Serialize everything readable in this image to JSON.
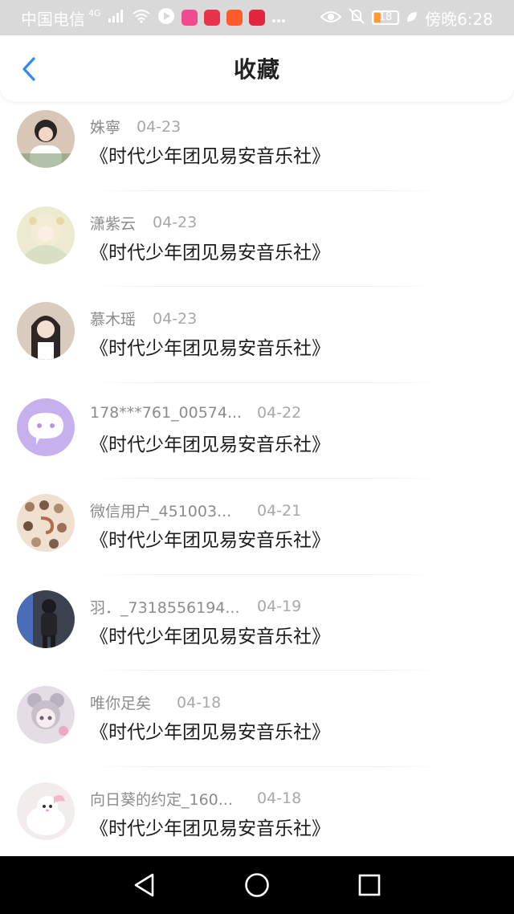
{
  "status_bar": {
    "carrier": "中国电信",
    "network": "4G",
    "battery": "18",
    "time": "傍晚6:28"
  },
  "header": {
    "title": "收藏"
  },
  "items": [
    {
      "name": "姝寧",
      "date": "04-23",
      "subject": "《时代少年团见易安音乐社》",
      "avatar_color": "#d8c7b6"
    },
    {
      "name": "潇紫云",
      "date": "04-23",
      "subject": "《时代少年团见易安音乐社》",
      "avatar_color": "#e9e4c6"
    },
    {
      "name": "慕木瑶",
      "date": "04-23",
      "subject": "《时代少年团见易安音乐社》",
      "avatar_color": "#cbb8a4"
    },
    {
      "name": "178***761_00574...",
      "date": "04-22",
      "subject": "《时代少年团见易安音乐社》",
      "avatar_color": "#c7b0ee"
    },
    {
      "name": "微信用户_451003...",
      "date": "04-21",
      "subject": "《时代少年团见易安音乐社》",
      "avatar_color": "#e7c9a7"
    },
    {
      "name": "羽．_7318556194...",
      "date": "04-19",
      "subject": "《时代少年团见易安音乐社》",
      "avatar_color": "#4a5060"
    },
    {
      "name": "唯你足矣",
      "date": "04-18",
      "subject": "《时代少年团见易安音乐社》",
      "avatar_color": "#ddd3e3"
    },
    {
      "name": "向日葵的约定_160...",
      "date": "04-18",
      "subject": "《时代少年团见易安音乐社》",
      "avatar_color": "#f0e6e4"
    }
  ],
  "colors": {
    "accent": "#2f8bf0",
    "status_bar_bg": "#d9d9d9",
    "nav_bar_bg": "#000000"
  }
}
